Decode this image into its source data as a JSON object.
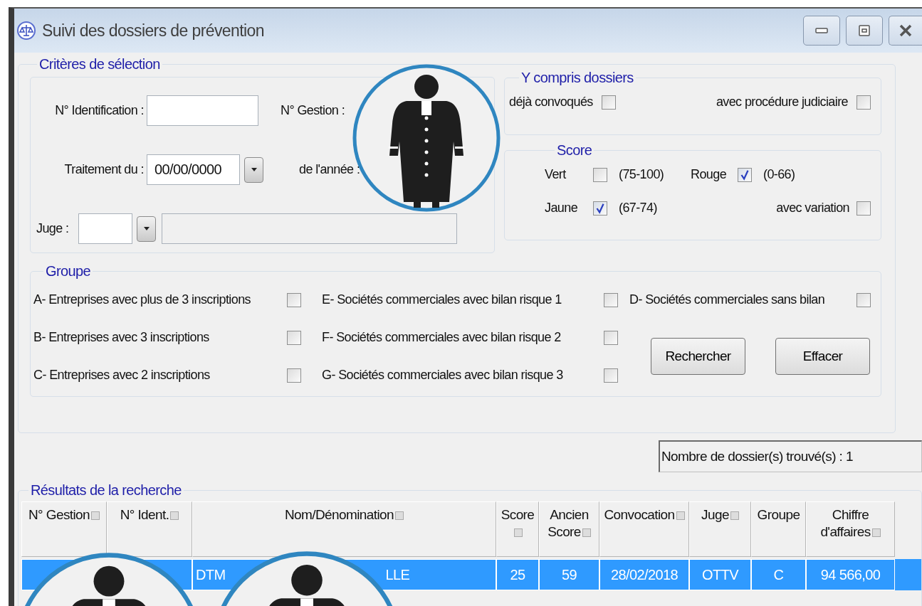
{
  "window": {
    "title": "Suivi des dossiers de prévention"
  },
  "criteria": {
    "title": "Critères de sélection",
    "identification": {
      "label": "N° Identification :"
    },
    "gestion": {
      "label": "N° Gestion :"
    },
    "traitement": {
      "label": "Traitement du :",
      "value": "00/00/0000"
    },
    "annee": {
      "label": "de l'année :"
    },
    "juge": {
      "label": "Juge :"
    }
  },
  "included": {
    "title": "Y compris dossiers",
    "options": [
      {
        "label": "déjà convoqués",
        "checked": false
      },
      {
        "label": "avec procédure judiciaire",
        "checked": false
      }
    ]
  },
  "score": {
    "title": "Score",
    "options": [
      {
        "label": "Vert",
        "range": "(75-100)",
        "checked": false
      },
      {
        "label": "Rouge",
        "range": "(0-66)",
        "checked": true
      },
      {
        "label": "Jaune",
        "range": "(67-74)",
        "checked": true
      },
      {
        "label": "avec variation",
        "checked": false
      }
    ]
  },
  "groups": {
    "title": "Groupe",
    "options": [
      {
        "label": "A- Entreprises avec plus de 3 inscriptions",
        "checked": false
      },
      {
        "label": "E- Sociétés commerciales avec bilan risque 1",
        "checked": false
      },
      {
        "label": "D- Sociétés commerciales sans bilan",
        "checked": false
      },
      {
        "label": "B- Entreprises avec 3 inscriptions",
        "checked": false
      },
      {
        "label": "F- Sociétés commerciales avec bilan risque 2",
        "checked": false
      },
      {
        "label": "C- Entreprises avec 2 inscriptions",
        "checked": false
      },
      {
        "label": "G- Sociétés commerciales avec bilan risque 3",
        "checked": false
      }
    ]
  },
  "buttons": [
    "Rechercher",
    "Effacer"
  ],
  "count": "Nombre de dossier(s) trouvé(s) : 1",
  "results": {
    "title": "Résultats de la recherche",
    "columns": [
      {
        "label": "N° Gestion",
        "filter": true
      },
      {
        "label": "N° Ident.",
        "filter": true
      },
      {
        "label": "Nom/Dénomination",
        "filter": true
      },
      {
        "label": "Score",
        "filter": true
      },
      {
        "label": "Ancien Score",
        "filter": true
      },
      {
        "label": "Convocation",
        "filter": true
      },
      {
        "label": "Juge",
        "filter": true
      },
      {
        "label": "Groupe",
        "filter": false
      },
      {
        "label": "Chiffre d'affaires",
        "filter": true
      }
    ],
    "rows": [
      {
        "selected": true,
        "cells": [
          "",
          "",
          [
            "DTM",
            "LLE"
          ],
          "25",
          "59",
          "28/02/2018",
          "OTTV",
          "C",
          "94 566,00"
        ]
      }
    ]
  }
}
